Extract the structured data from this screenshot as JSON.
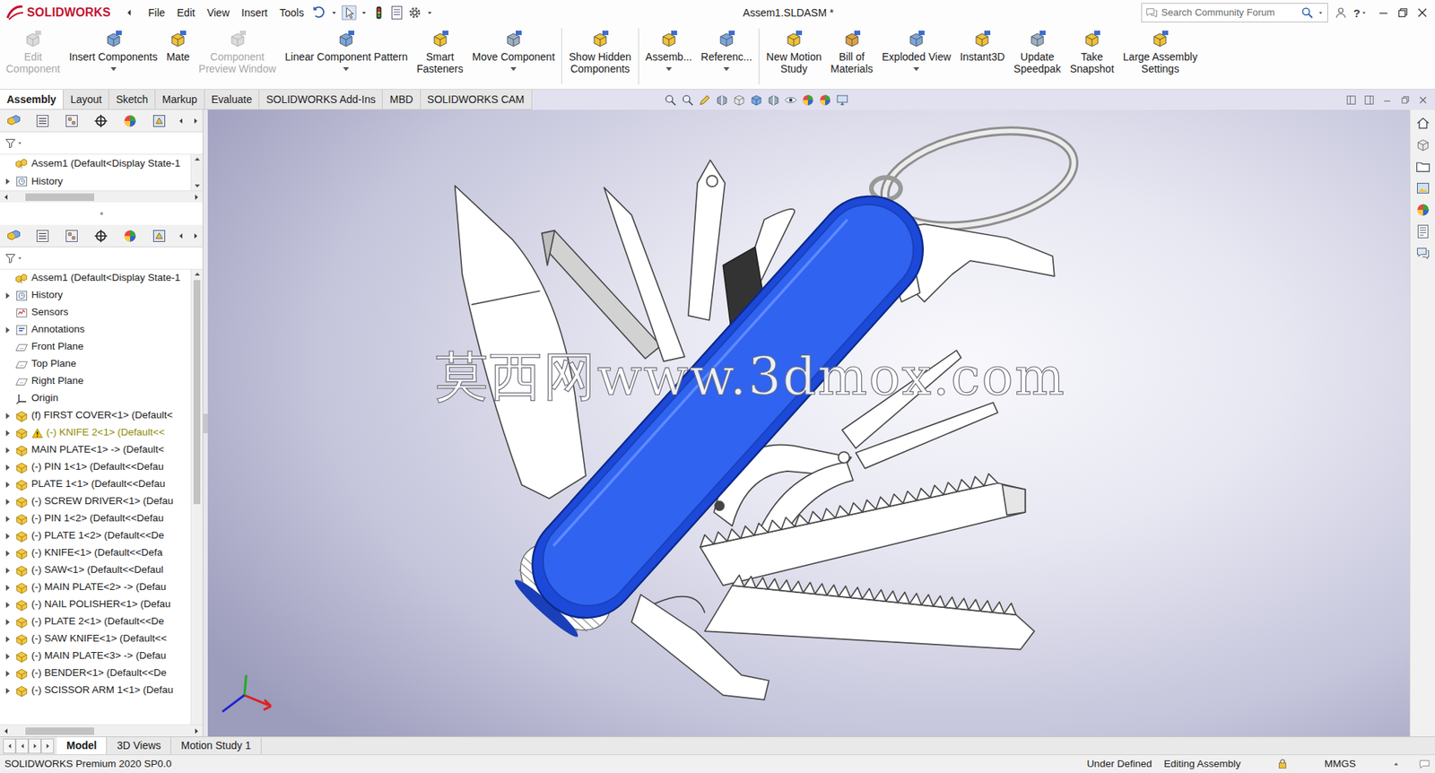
{
  "app": {
    "logo": "SOLIDWORKS",
    "title": "Assem1.SLDASM *",
    "help": "?"
  },
  "menu": [
    "File",
    "Edit",
    "View",
    "Insert",
    "Tools"
  ],
  "search": {
    "placeholder": "Search Community Forum"
  },
  "ribbon": [
    [
      {
        "lines": [
          "Edit",
          "Component"
        ],
        "disabled": true,
        "dropdown": false
      },
      {
        "lines": [
          "Insert Components"
        ],
        "disabled": false,
        "dropdown": true
      },
      {
        "lines": [
          "Mate"
        ],
        "disabled": false,
        "dropdown": false
      },
      {
        "lines": [
          "Component",
          "Preview Window"
        ],
        "disabled": true,
        "dropdown": false
      },
      {
        "lines": [
          "Linear Component Pattern"
        ],
        "disabled": false,
        "dropdown": true
      },
      {
        "lines": [
          "Smart",
          "Fasteners"
        ],
        "disabled": false,
        "dropdown": false
      },
      {
        "lines": [
          "Move Component"
        ],
        "disabled": false,
        "dropdown": true
      }
    ],
    [
      {
        "lines": [
          "Show Hidden",
          "Components"
        ],
        "disabled": false,
        "dropdown": false
      }
    ],
    [
      {
        "lines": [
          "Assemb..."
        ],
        "disabled": false,
        "dropdown": true
      },
      {
        "lines": [
          "Referenc..."
        ],
        "disabled": false,
        "dropdown": true
      }
    ],
    [
      {
        "lines": [
          "New Motion",
          "Study"
        ],
        "disabled": false,
        "dropdown": false
      },
      {
        "lines": [
          "Bill of",
          "Materials"
        ],
        "disabled": false,
        "dropdown": false
      },
      {
        "lines": [
          "Exploded View"
        ],
        "disabled": false,
        "dropdown": true
      },
      {
        "lines": [
          "Instant3D"
        ],
        "disabled": false,
        "dropdown": false
      },
      {
        "lines": [
          "Update",
          "Speedpak"
        ],
        "disabled": false,
        "dropdown": false
      },
      {
        "lines": [
          "Take",
          "Snapshot"
        ],
        "disabled": false,
        "dropdown": false
      },
      {
        "lines": [
          "Large Assembly",
          "Settings"
        ],
        "disabled": false,
        "dropdown": false
      }
    ]
  ],
  "tabs": [
    {
      "label": "Assembly",
      "selected": true
    },
    {
      "label": "Layout",
      "selected": false
    },
    {
      "label": "Sketch",
      "selected": false
    },
    {
      "label": "Markup",
      "selected": false
    },
    {
      "label": "Evaluate",
      "selected": false
    },
    {
      "label": "SOLIDWORKS Add-Ins",
      "selected": false
    },
    {
      "label": "MBD",
      "selected": false
    },
    {
      "label": "SOLIDWORKS CAM",
      "selected": false
    }
  ],
  "tree_top": {
    "items": [
      {
        "label": "Assem1 (Default<Display State-1",
        "kind": "assembly",
        "expandable": false,
        "warning": false
      },
      {
        "label": "History",
        "kind": "history",
        "expandable": true,
        "warning": false
      }
    ]
  },
  "tree": {
    "items": [
      {
        "label": "Assem1 (Default<Display State-1",
        "kind": "assembly",
        "expandable": false,
        "warning": false
      },
      {
        "label": "History",
        "kind": "history",
        "expandable": true,
        "warning": false
      },
      {
        "label": "Sensors",
        "kind": "sensor",
        "expandable": false,
        "warning": false
      },
      {
        "label": "Annotations",
        "kind": "annotation",
        "expandable": true,
        "warning": false
      },
      {
        "label": "Front Plane",
        "kind": "plane",
        "expandable": false,
        "warning": false
      },
      {
        "label": "Top Plane",
        "kind": "plane",
        "expandable": false,
        "warning": false
      },
      {
        "label": "Right Plane",
        "kind": "plane",
        "expandable": false,
        "warning": false
      },
      {
        "label": "Origin",
        "kind": "origin",
        "expandable": false,
        "warning": false
      },
      {
        "label": "(f) FIRST COVER<1> (Default<",
        "kind": "part",
        "expandable": true,
        "warning": false
      },
      {
        "label": "(-) KNIFE 2<1> (Default<<",
        "kind": "part",
        "expandable": true,
        "warning": true
      },
      {
        "label": "MAIN PLATE<1> -> (Default<",
        "kind": "part",
        "expandable": true,
        "warning": false
      },
      {
        "label": "(-) PIN 1<1> (Default<<Defau",
        "kind": "part",
        "expandable": true,
        "warning": false
      },
      {
        "label": "PLATE 1<1> (Default<<Defau",
        "kind": "part",
        "expandable": true,
        "warning": false
      },
      {
        "label": "(-) SCREW DRIVER<1> (Defau",
        "kind": "part",
        "expandable": true,
        "warning": false
      },
      {
        "label": "(-) PIN 1<2> (Default<<Defau",
        "kind": "part",
        "expandable": true,
        "warning": false
      },
      {
        "label": "(-) PLATE 1<2> (Default<<De",
        "kind": "part",
        "expandable": true,
        "warning": false
      },
      {
        "label": "(-) KNIFE<1> (Default<<Defa",
        "kind": "part",
        "expandable": true,
        "warning": false
      },
      {
        "label": "(-) SAW<1> (Default<<Defaul",
        "kind": "part",
        "expandable": true,
        "warning": false
      },
      {
        "label": "(-) MAIN PLATE<2> -> (Defau",
        "kind": "part",
        "expandable": true,
        "warning": false
      },
      {
        "label": "(-) NAIL POLISHER<1> (Defau",
        "kind": "part",
        "expandable": true,
        "warning": false
      },
      {
        "label": "(-) PLATE 2<1> (Default<<De",
        "kind": "part",
        "expandable": true,
        "warning": false
      },
      {
        "label": "(-) SAW KNIFE<1> (Default<<",
        "kind": "part",
        "expandable": true,
        "warning": false
      },
      {
        "label": "(-) MAIN PLATE<3> -> (Defau",
        "kind": "part",
        "expandable": true,
        "warning": false
      },
      {
        "label": "(-) BENDER<1> (Default<<De",
        "kind": "part",
        "expandable": true,
        "warning": false
      },
      {
        "label": "(-) SCISSOR ARM 1<1> (Defau",
        "kind": "part",
        "expandable": true,
        "warning": false
      }
    ]
  },
  "viewport": {
    "watermark": "莫西网www.3dmox.com"
  },
  "bottom_tabs": [
    {
      "label": "Model",
      "selected": true
    },
    {
      "label": "3D Views",
      "selected": false
    },
    {
      "label": "Motion Study 1",
      "selected": false
    }
  ],
  "status_bar": {
    "product": "SOLIDWORKS Premium 2020 SP0.0",
    "state": "Under Defined",
    "mode": "Editing Assembly",
    "units": "MMGS"
  }
}
